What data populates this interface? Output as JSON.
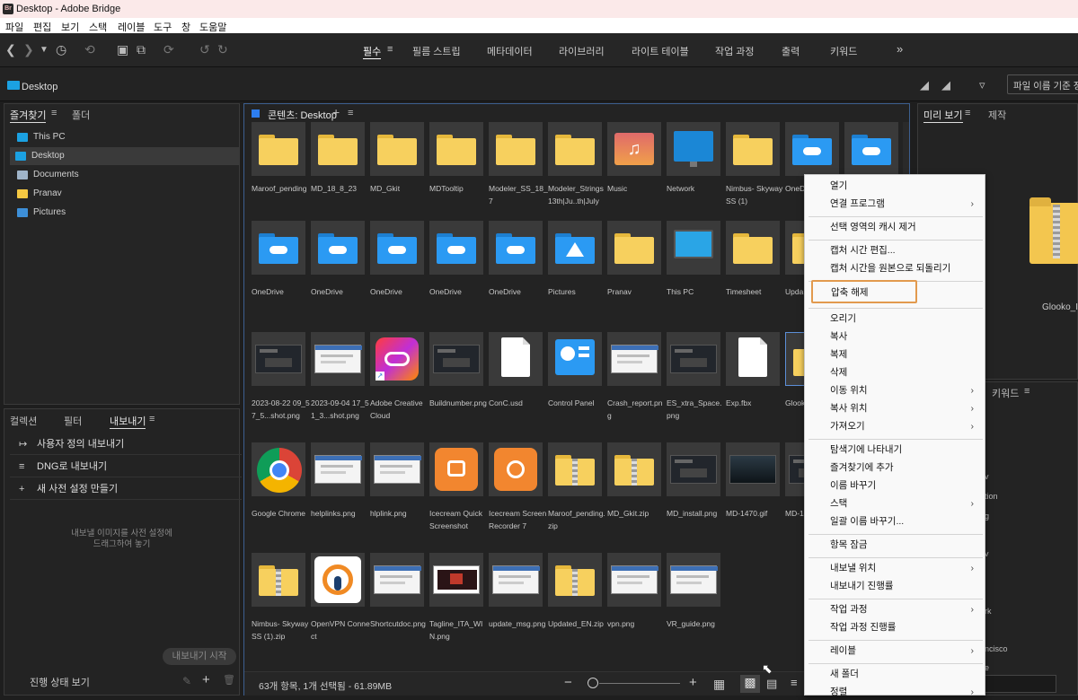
{
  "window": {
    "title": "Desktop - Adobe Bridge",
    "logo": "Br"
  },
  "menu": [
    "파일",
    "편집",
    "보기",
    "스택",
    "레이블",
    "도구",
    "창",
    "도움말"
  ],
  "workspaces": [
    "필수",
    "필름 스트립",
    "메타데이터",
    "라이브러리",
    "라이트 테이블",
    "작업 과정",
    "출력",
    "키워드"
  ],
  "path": {
    "label": "Desktop",
    "sort": "파일 이름 기준 정"
  },
  "favorites": {
    "tabs": [
      "즐겨찾기",
      "폴더"
    ],
    "items": [
      "This PC",
      "Desktop",
      "Documents",
      "Pranav",
      "Pictures"
    ]
  },
  "bottom_left": {
    "tabs": [
      "컬렉션",
      "필터",
      "내보내기"
    ],
    "rows": [
      "사용자 정의 내보내기",
      "DNG로 내보내기",
      "새 사전 설정 만들기"
    ],
    "hint1": "내보낼 이미지를 사전 설정에",
    "hint2": "드래그하여 놓기",
    "start_button": "내보내기 시작",
    "progress": "진행 상태 보기"
  },
  "content": {
    "tab": "콘텐츠: Desktop"
  },
  "rows": [
    [
      [
        "Maroof_pending",
        "folder"
      ],
      [
        "MD_18_8_23",
        "folder"
      ],
      [
        "MD_Gkit",
        "folder"
      ],
      [
        "MDTooltip",
        "folder"
      ],
      [
        "Modeler_SS_18_7",
        "folder"
      ],
      [
        "Modeler_Strings13th|Ju..th|July",
        "folder"
      ],
      [
        "Music",
        "music"
      ],
      [
        "Network",
        "network"
      ],
      [
        "Nimbus- Skyway SS (1)",
        "folder"
      ],
      [
        "OneD",
        "onedrive"
      ],
      [
        "",
        "onedrive"
      ]
    ],
    [
      [
        "OneDrive",
        "onedrive"
      ],
      [
        "OneDrive",
        "onedrive"
      ],
      [
        "OneDrive",
        "onedrive"
      ],
      [
        "OneDrive",
        "onedrive"
      ],
      [
        "OneDrive",
        "onedrive"
      ],
      [
        "Pictures",
        "pictures"
      ],
      [
        "Pranav",
        "folder"
      ],
      [
        "This PC",
        "pc"
      ],
      [
        "Timesheet",
        "folder"
      ],
      [
        "Upda",
        "folder"
      ]
    ],
    [
      [
        "2023-08-22 09_57_5...shot.png",
        "shotdark"
      ],
      [
        "2023-09-04 17_51_3...shot.png",
        "shotlight"
      ],
      [
        "Adobe Creative Cloud",
        "cc"
      ],
      [
        "Buildnumber.png",
        "shotdark"
      ],
      [
        "ConC.usd",
        "doc"
      ],
      [
        "Control Panel",
        "cpanel"
      ],
      [
        "Crash_report.png",
        "shotlight"
      ],
      [
        "ES_xtra_Space.png",
        "shotdark"
      ],
      [
        "Exp.fbx",
        "doc"
      ],
      [
        "Glook",
        "zipsel"
      ]
    ],
    [
      [
        "Google Chrome",
        "chrome"
      ],
      [
        "helplinks.png",
        "shotlight"
      ],
      [
        "hlplink.png",
        "shotlight"
      ],
      [
        "Icecream Quick Screenshot",
        "icecream"
      ],
      [
        "Icecream Screen Recorder 7",
        "icecream2"
      ],
      [
        "Maroof_pending.zip",
        "zip"
      ],
      [
        "MD_Gkit.zip",
        "zip"
      ],
      [
        "MD_install.png",
        "shotdark"
      ],
      [
        "MD-1470.gif",
        "game"
      ],
      [
        "MD-14",
        "shotdark"
      ]
    ],
    [
      [
        "Nimbus- Skyway SS (1).zip",
        "zip"
      ],
      [
        "OpenVPN Connect",
        "vpn"
      ],
      [
        "Shortcutdoc.png",
        "shotlight"
      ],
      [
        "Tagline_ITA_WIN.png",
        "shotred"
      ],
      [
        "update_msg.png",
        "shotlight"
      ],
      [
        "Updated_EN.zip",
        "zip"
      ],
      [
        "vpn.png",
        "shotlight"
      ],
      [
        "VR_guide.png",
        "shotlight"
      ]
    ]
  ],
  "status": {
    "text": "63개 항목, 1개 선택됨 - 61.89MB"
  },
  "preview": {
    "tabs": [
      "미리 보기",
      "제작"
    ],
    "filename": "Glooko_IC"
  },
  "keywords": {
    "tab": "키워드",
    "fragments": [
      "v",
      "tion",
      "g",
      "v",
      "rk",
      "ncisco",
      "e"
    ]
  },
  "context_menu": {
    "items": [
      {
        "label": "열기",
        "arrow": false
      },
      {
        "label": "연결 프로그램",
        "arrow": true
      },
      {
        "sep": true
      },
      {
        "label": "선택 영역의 캐시 제거",
        "arrow": false
      },
      {
        "sep": true
      },
      {
        "label": "캡처 시간 편집...",
        "arrow": false
      },
      {
        "label": "캡처 시간을 원본으로 되돌리기",
        "arrow": false
      },
      {
        "sep": true
      },
      {
        "label": "압축 해제",
        "arrow": false,
        "highlight": true
      },
      {
        "sep": true
      },
      {
        "label": "오리기",
        "arrow": false
      },
      {
        "label": "복사",
        "arrow": false
      },
      {
        "label": "복제",
        "arrow": false
      },
      {
        "label": "삭제",
        "arrow": false
      },
      {
        "label": "이동 위치",
        "arrow": true
      },
      {
        "label": "복사 위치",
        "arrow": true
      },
      {
        "label": "가져오기",
        "arrow": true
      },
      {
        "sep": true
      },
      {
        "label": "탐색기에 나타내기",
        "arrow": false
      },
      {
        "label": "즐겨찾기에 추가",
        "arrow": false
      },
      {
        "label": "이름 바꾸기",
        "arrow": false
      },
      {
        "label": "스택",
        "arrow": true
      },
      {
        "label": "일괄 이름 바꾸기...",
        "arrow": false
      },
      {
        "sep": true
      },
      {
        "label": "항목 잠금",
        "arrow": false
      },
      {
        "sep": true
      },
      {
        "label": "내보낼 위치",
        "arrow": true
      },
      {
        "label": "내보내기 진행률",
        "arrow": false
      },
      {
        "sep": true
      },
      {
        "label": "작업 과정",
        "arrow": true
      },
      {
        "label": "작업 과정 진행률",
        "arrow": false
      },
      {
        "sep": true
      },
      {
        "label": "레이블",
        "arrow": true
      },
      {
        "sep": true
      },
      {
        "label": "새 폴더",
        "arrow": false
      },
      {
        "label": "정렬",
        "arrow": true
      }
    ]
  }
}
